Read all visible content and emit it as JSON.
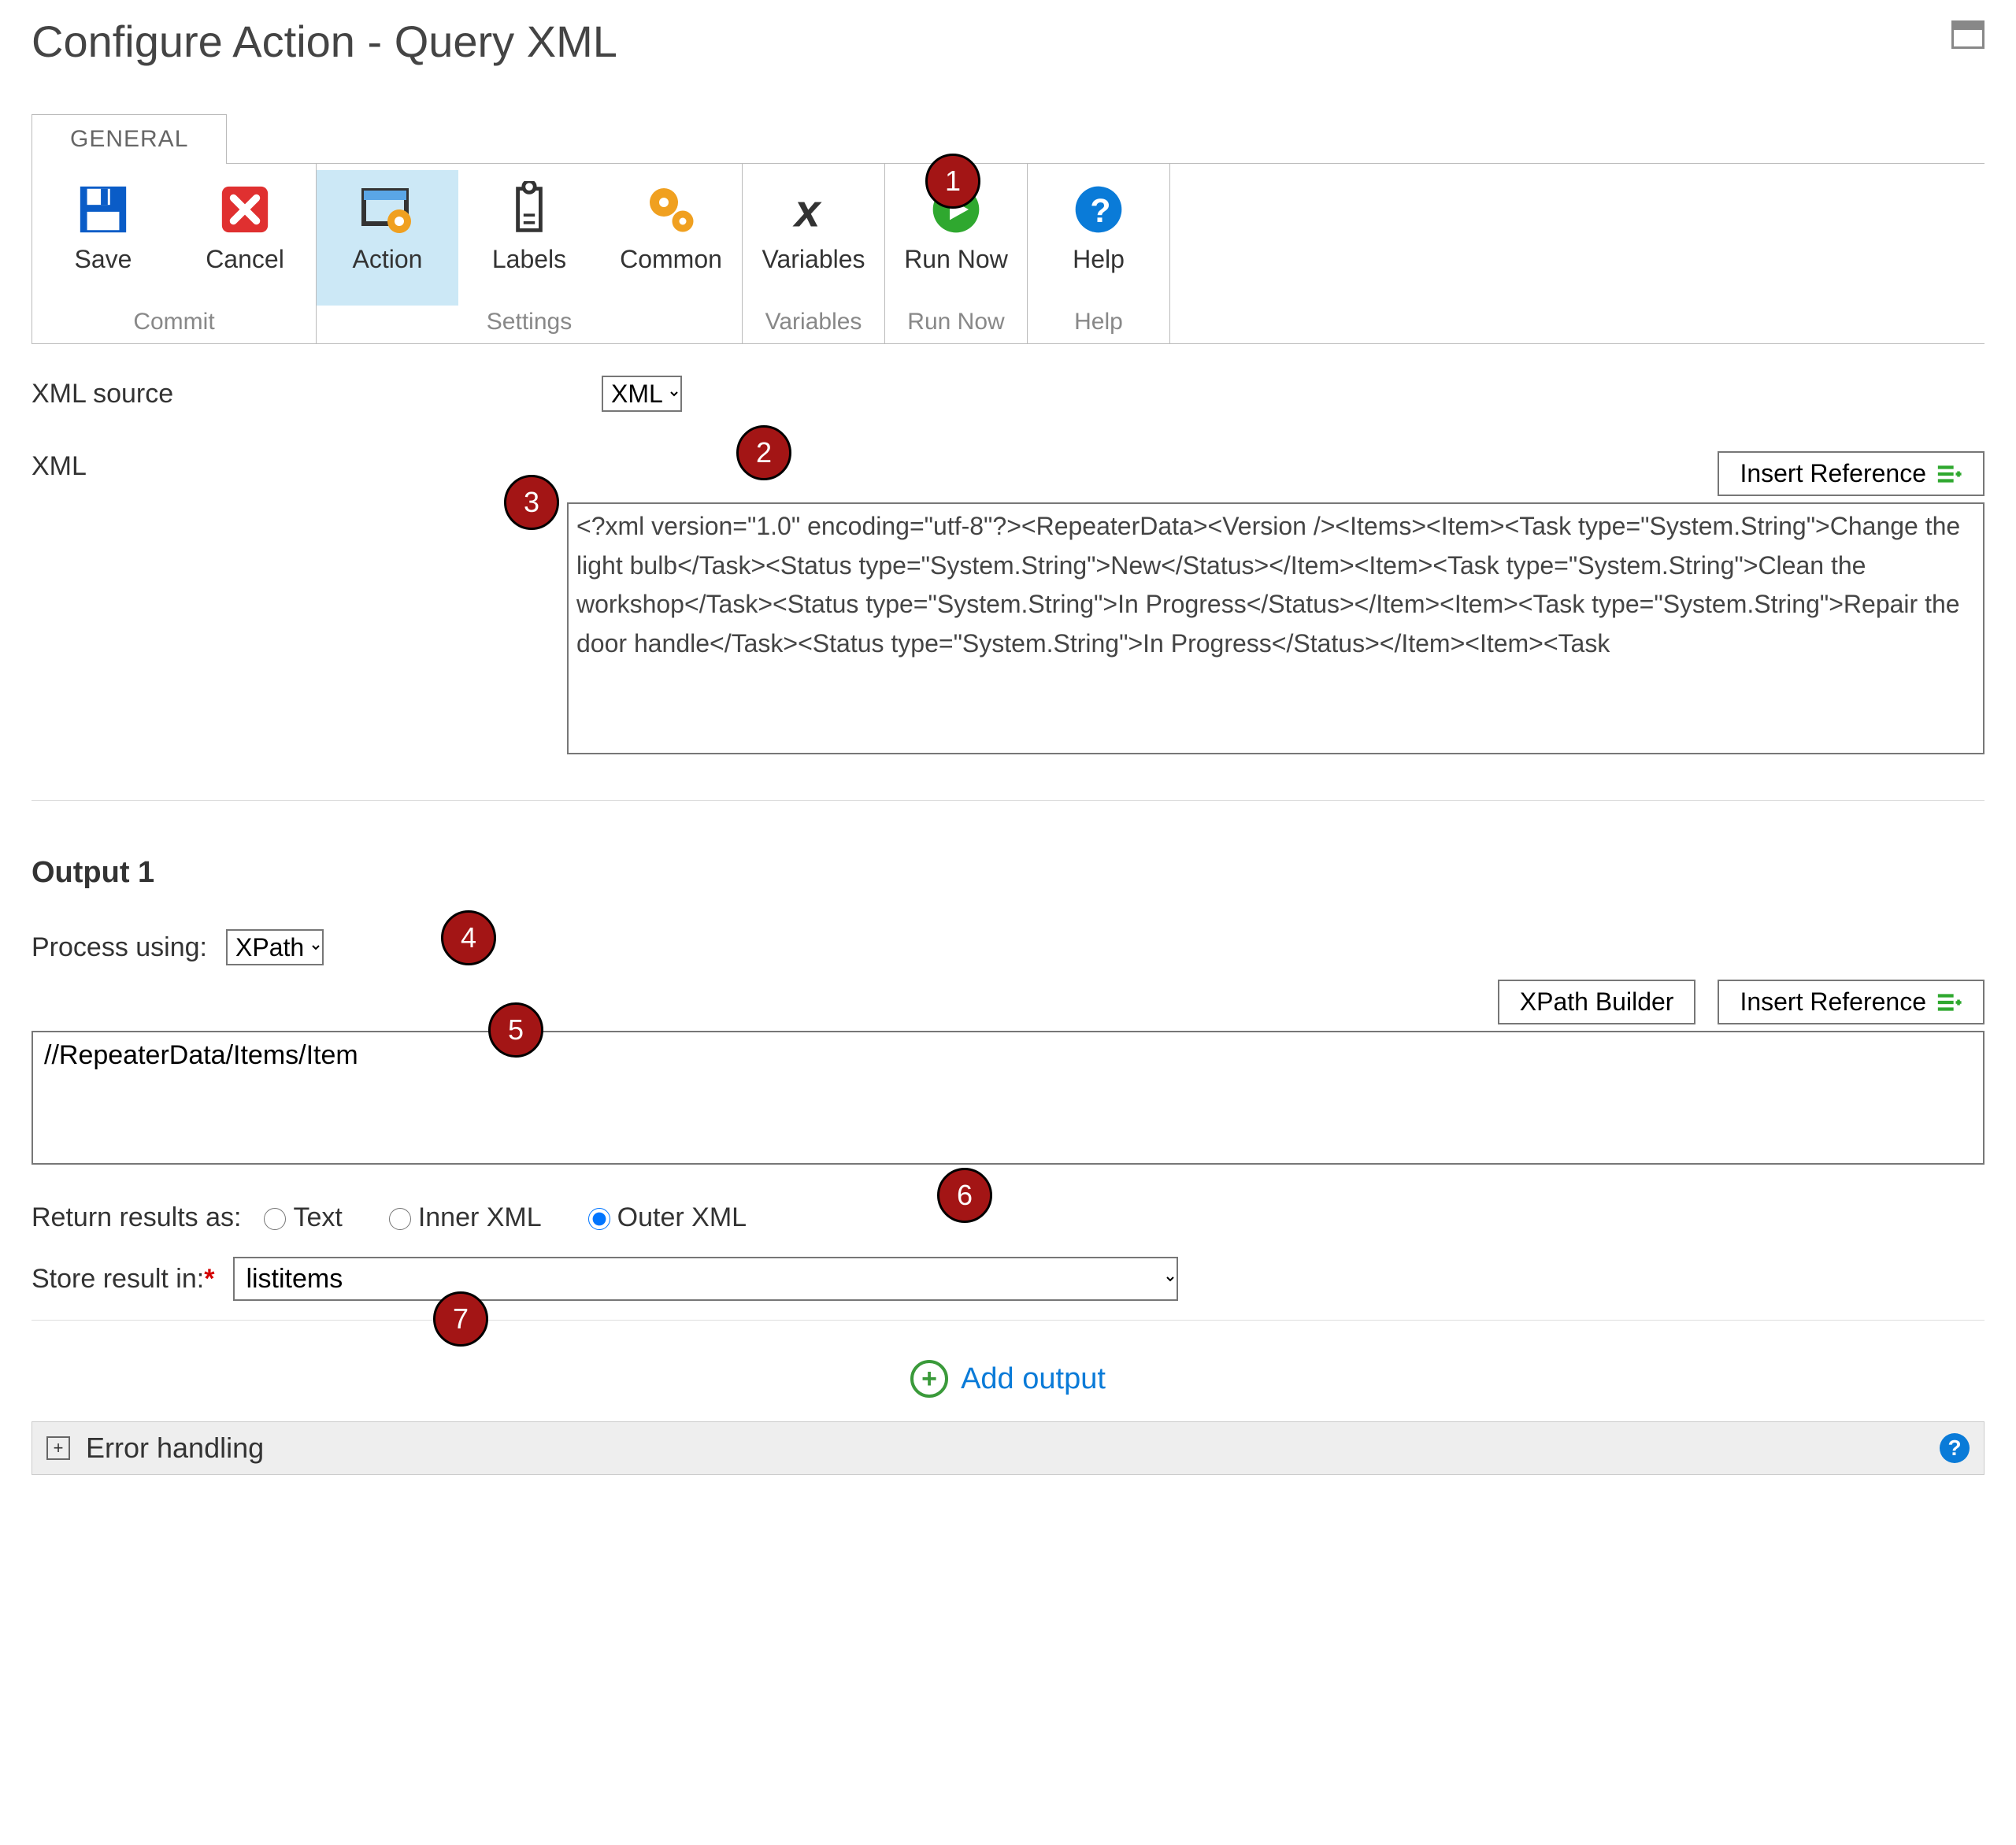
{
  "title": "Configure Action - Query XML",
  "tab": "GENERAL",
  "ribbon": {
    "groups": [
      {
        "label": "Commit",
        "items": [
          {
            "id": "save",
            "label": "Save"
          },
          {
            "id": "cancel",
            "label": "Cancel"
          }
        ]
      },
      {
        "label": "Settings",
        "items": [
          {
            "id": "action",
            "label": "Action",
            "active": true
          },
          {
            "id": "labels",
            "label": "Labels"
          },
          {
            "id": "common",
            "label": "Common"
          }
        ]
      },
      {
        "label": "Variables",
        "items": [
          {
            "id": "variables",
            "label": "Variables"
          }
        ]
      },
      {
        "label": "Run Now",
        "items": [
          {
            "id": "runnow",
            "label": "Run Now"
          }
        ]
      },
      {
        "label": "Help",
        "items": [
          {
            "id": "help",
            "label": "Help"
          }
        ]
      }
    ]
  },
  "xmlSource": {
    "label": "XML source",
    "value": "XML"
  },
  "xml": {
    "label": "XML",
    "insertRef": "Insert Reference",
    "content": "<?xml version=\"1.0\" encoding=\"utf-8\"?><RepeaterData><Version /><Items><Item><Task type=\"System.String\">Change the light bulb</Task><Status type=\"System.String\">New</Status></Item><Item><Task type=\"System.String\">Clean the workshop</Task><Status type=\"System.String\">In Progress</Status></Item><Item><Task type=\"System.String\">Repair the door handle</Task><Status type=\"System.String\">In Progress</Status></Item><Item><Task"
  },
  "output": {
    "heading": "Output 1",
    "processUsingLabel": "Process using:",
    "processUsingValue": "XPath",
    "xpathBuilder": "XPath Builder",
    "insertRef": "Insert Reference",
    "xpath": "//RepeaterData/Items/Item",
    "returnLabel": "Return results as:",
    "returnOptions": {
      "text": "Text",
      "inner": "Inner XML",
      "outer": "Outer XML"
    },
    "storeLabel": "Store result in:",
    "storeValue": "listitems",
    "addOutput": "Add output"
  },
  "errorHandling": "Error handling",
  "callouts": {
    "1": "1",
    "2": "2",
    "3": "3",
    "4": "4",
    "5": "5",
    "6": "6",
    "7": "7"
  }
}
